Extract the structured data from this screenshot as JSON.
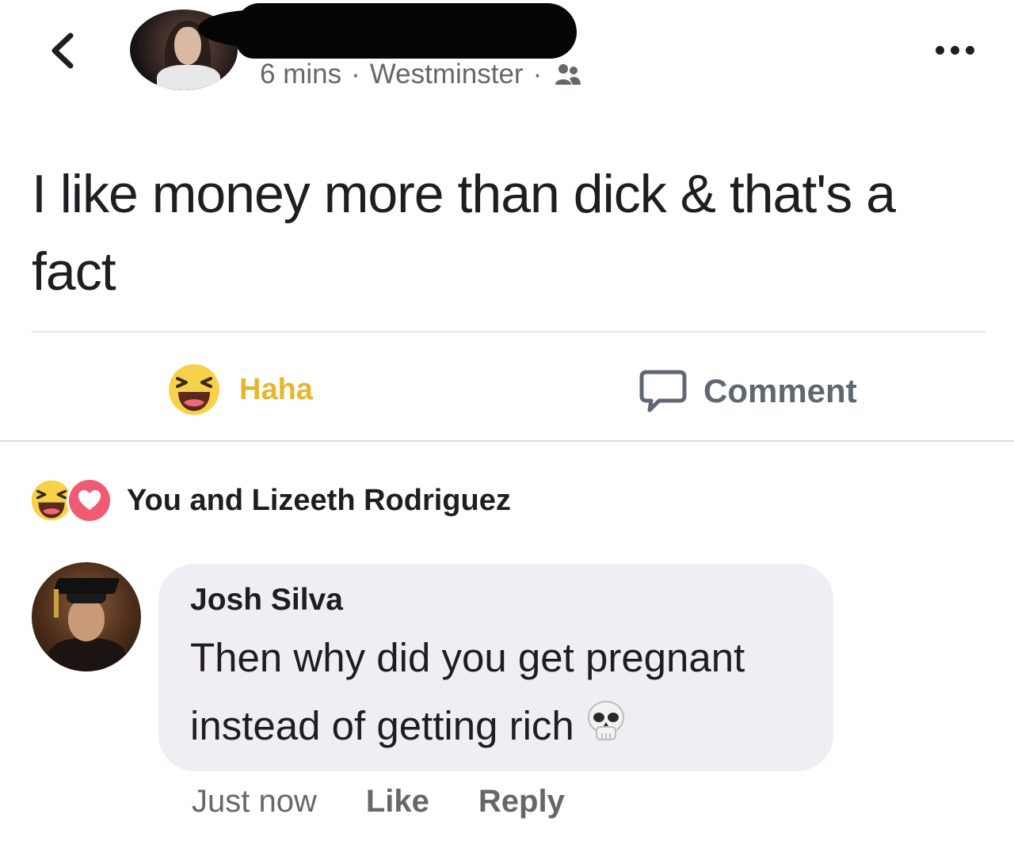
{
  "post": {
    "time": "6 mins",
    "separator": "·",
    "location": "Westminster",
    "audience_icon": "friends-icon",
    "text": "I like money more than dick & that's a fact"
  },
  "actions": {
    "haha_label": "Haha",
    "haha_icon": "haha-emoji-icon",
    "comment_label": "Comment",
    "comment_icon": "speech-bubble-icon"
  },
  "reactions": {
    "icons": [
      "haha-emoji-icon",
      "love-heart-icon"
    ],
    "summary": "You and Lizeeth Rodriguez"
  },
  "comment": {
    "author": "Josh Silva",
    "text": "Then why did you get pregnant instead of getting rich",
    "emoji": "skull-emoji-icon",
    "time": "Just now",
    "like_label": "Like",
    "reply_label": "Reply"
  },
  "colors": {
    "haha_yellow": "#e7b62c",
    "love_pink": "#f05a73",
    "secondary_text": "#65676b",
    "bubble_bg": "#f0eef3"
  }
}
